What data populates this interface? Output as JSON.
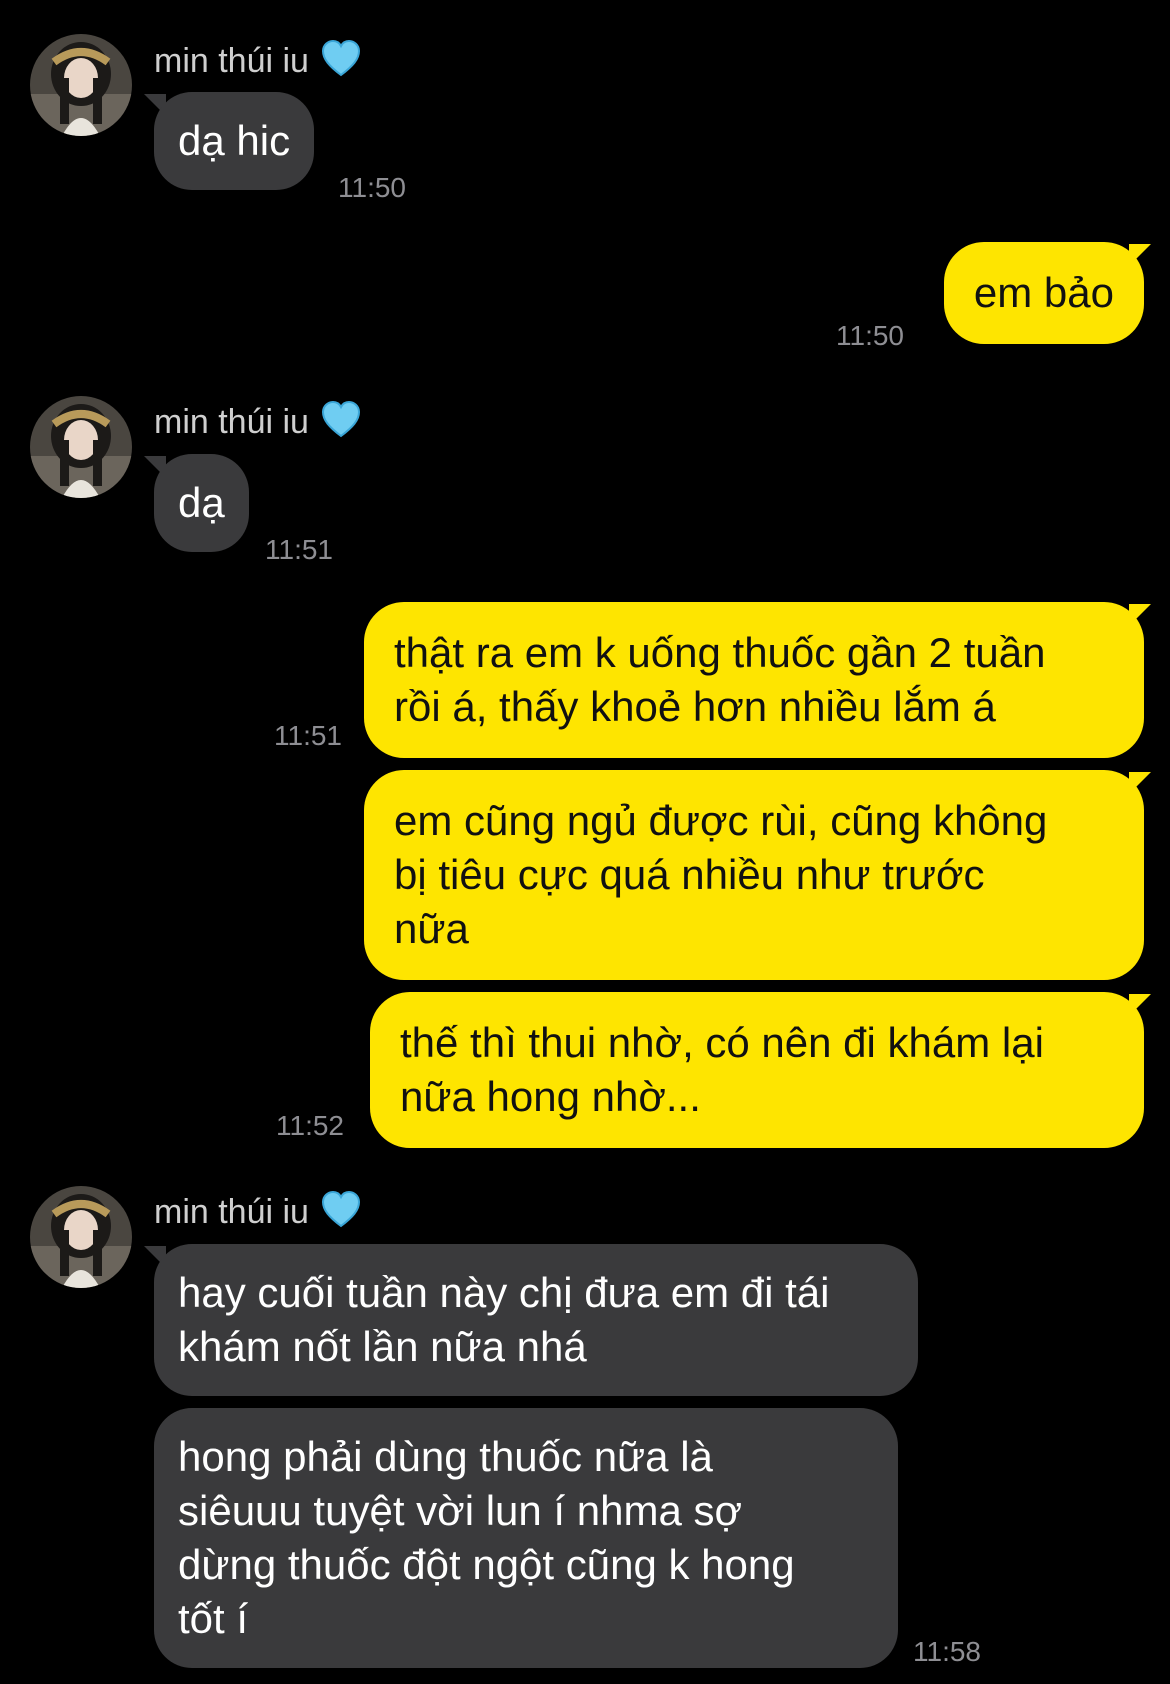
{
  "contact": {
    "name": "min thúi iu",
    "heart_icon": "light-blue-heart-icon",
    "heart_color": "#6fcdf2"
  },
  "colors": {
    "background": "#000000",
    "incoming_bubble": "#3a3a3c",
    "outgoing_bubble": "#fee500",
    "timestamp": "#8e8e93"
  },
  "messages": [
    {
      "sender": "min thúi iu",
      "text": "dạ hic",
      "time": "11:50",
      "direction": "incoming"
    },
    {
      "text": "em bảo",
      "time": "11:50",
      "direction": "outgoing"
    },
    {
      "sender": "min thúi iu",
      "text": "dạ",
      "time": "11:51",
      "direction": "incoming"
    },
    {
      "text": "thật ra em k uống thuốc gần 2 tuần\nrồi á, thấy khoẻ hơn nhiều lắm á",
      "time": "11:51",
      "direction": "outgoing"
    },
    {
      "text": "em cũng ngủ được rùi, cũng không\nbị tiêu cực quá nhiều như trước\nnữa",
      "direction": "outgoing"
    },
    {
      "text": "thế thì thui nhờ, có nên đi khám lại\nnữa hong nhờ...",
      "time": "11:52",
      "direction": "outgoing"
    },
    {
      "sender": "min thúi iu",
      "text": "hay cuối tuần này chị đưa em đi tái\nkhám nốt lần nữa nhá",
      "direction": "incoming"
    },
    {
      "text": "hong phải dùng thuốc nữa là\nsiêuuu tuyệt vời lun í nhma sợ\ndừng thuốc đột ngột cũng k hong\ntốt í",
      "time": "11:58",
      "direction": "incoming"
    }
  ]
}
